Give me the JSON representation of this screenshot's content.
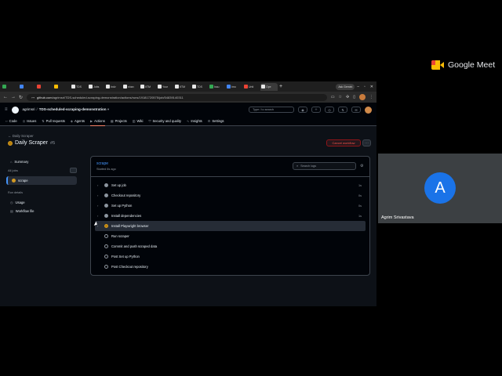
{
  "meet": {
    "logo_text": "Google Meet",
    "participant": {
      "initial": "A",
      "name": "Agrim Srivastava"
    },
    "colors": {
      "avatar": "#1a73e8",
      "tile": "#3c4043"
    }
  },
  "browser": {
    "tabs": [
      {
        "label": "",
        "icon": "app-icon"
      },
      {
        "label": "",
        "icon": "app-icon"
      },
      {
        "label": "",
        "icon": "app-icon"
      },
      {
        "label": "",
        "icon": "app-icon"
      },
      {
        "label": "TDS",
        "icon": "github-icon"
      },
      {
        "label": "Jobs",
        "icon": "github-icon"
      },
      {
        "label": "Indv",
        "icon": "github-icon"
      },
      {
        "label": "shan",
        "icon": "github-icon"
      },
      {
        "label": "IITM",
        "icon": "github-icon"
      },
      {
        "label": "Your",
        "icon": "github-icon"
      },
      {
        "label": "IITM",
        "icon": "github-icon"
      },
      {
        "label": "TDS",
        "icon": "github-icon"
      },
      {
        "label": "Issu",
        "icon": "app-icon"
      },
      {
        "label": "Imo",
        "icon": "app-icon"
      },
      {
        "label": "Unti",
        "icon": "app-icon"
      },
      {
        "label": "Ope",
        "icon": "github-icon"
      }
    ],
    "new_tab": "+",
    "ask_gemini": "Ask Gemini",
    "url_domain": "github.com",
    "url_path": "/agrimsri/TDS-scheduled-scraping-demonstration/actions/runs/19181720575/job/54839140311"
  },
  "github": {
    "owner": "agrimsri",
    "repo": "TDS-scheduled-scraping-demonstration",
    "search_placeholder": "Type / to search",
    "nav": [
      {
        "label": "Code",
        "icon": "code-icon"
      },
      {
        "label": "Issues",
        "icon": "issue-icon"
      },
      {
        "label": "Pull requests",
        "icon": "pr-icon"
      },
      {
        "label": "Agents",
        "icon": "agent-icon"
      },
      {
        "label": "Actions",
        "icon": "play-icon",
        "selected": true
      },
      {
        "label": "Projects",
        "icon": "table-icon"
      },
      {
        "label": "Wiki",
        "icon": "book-icon"
      },
      {
        "label": "Security and quality",
        "icon": "shield-icon"
      },
      {
        "label": "Insights",
        "icon": "graph-icon"
      },
      {
        "label": "Settings",
        "icon": "gear-icon"
      }
    ],
    "run": {
      "back_label": "← Daily Scraper",
      "title": "Daily Scraper",
      "number": "#5",
      "cancel_label": "Cancel workflow"
    },
    "sidebar": {
      "summary": "Summary",
      "all_jobs": "All jobs",
      "job": "scrape",
      "run_details": "Run details",
      "usage": "Usage",
      "workflow_file": "Workflow file"
    },
    "job": {
      "name": "scrape",
      "status": "Started 6s ago",
      "search_placeholder": "Search logs",
      "steps": [
        {
          "label": "Set up job",
          "duration": "1s",
          "state": "ok"
        },
        {
          "label": "Checkout repository",
          "duration": "0s",
          "state": "ok"
        },
        {
          "label": "Set up Python",
          "duration": "0s",
          "state": "ok"
        },
        {
          "label": "Install dependencies",
          "duration": "1s",
          "state": "ok"
        },
        {
          "label": "Install Playwright browser",
          "duration": "",
          "state": "run",
          "active": true
        },
        {
          "label": "Run scraper",
          "duration": "",
          "state": "pend"
        },
        {
          "label": "Commit and push scraped data",
          "duration": "",
          "state": "pend"
        },
        {
          "label": "Post Set up Python",
          "duration": "",
          "state": "pend"
        },
        {
          "label": "Post Checkout repository",
          "duration": "",
          "state": "pend"
        }
      ]
    }
  }
}
